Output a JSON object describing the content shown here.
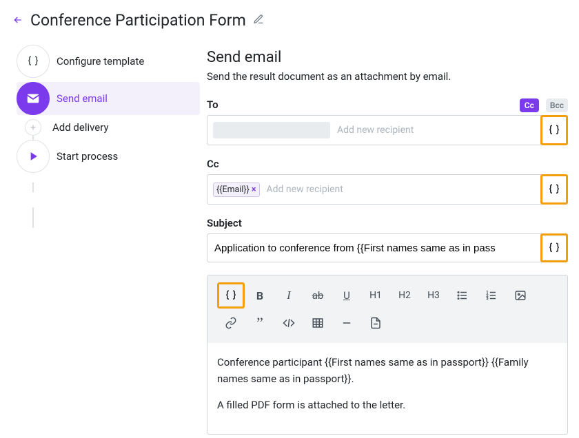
{
  "header": {
    "title": "Conference Participation Form"
  },
  "sidebar": {
    "steps": [
      {
        "label": "Configure template"
      },
      {
        "label": "Send email"
      },
      {
        "label": "Add delivery"
      },
      {
        "label": "Start process"
      }
    ]
  },
  "main": {
    "title": "Send email",
    "description": "Send the result document as an attachment by email.",
    "to": {
      "label": "To",
      "placeholder": "Add new recipient",
      "cc_badge": "Cc",
      "bcc_badge": "Bcc"
    },
    "cc": {
      "label": "Cc",
      "token": "{{Email}}",
      "placeholder": "Add new recipient"
    },
    "subject": {
      "label": "Subject",
      "value": "Application to conference from {{First names same as in pass"
    },
    "toolbar": {
      "bold": "B",
      "italic": "I",
      "strike": "ab",
      "underline": "U",
      "h1": "H1",
      "h2": "H2",
      "h3": "H3"
    },
    "body": {
      "line1": "Conference participant {{First names same as in passport}} {{Family names same as in passport}}.",
      "line2": "A filled PDF form is attached to the letter."
    }
  }
}
